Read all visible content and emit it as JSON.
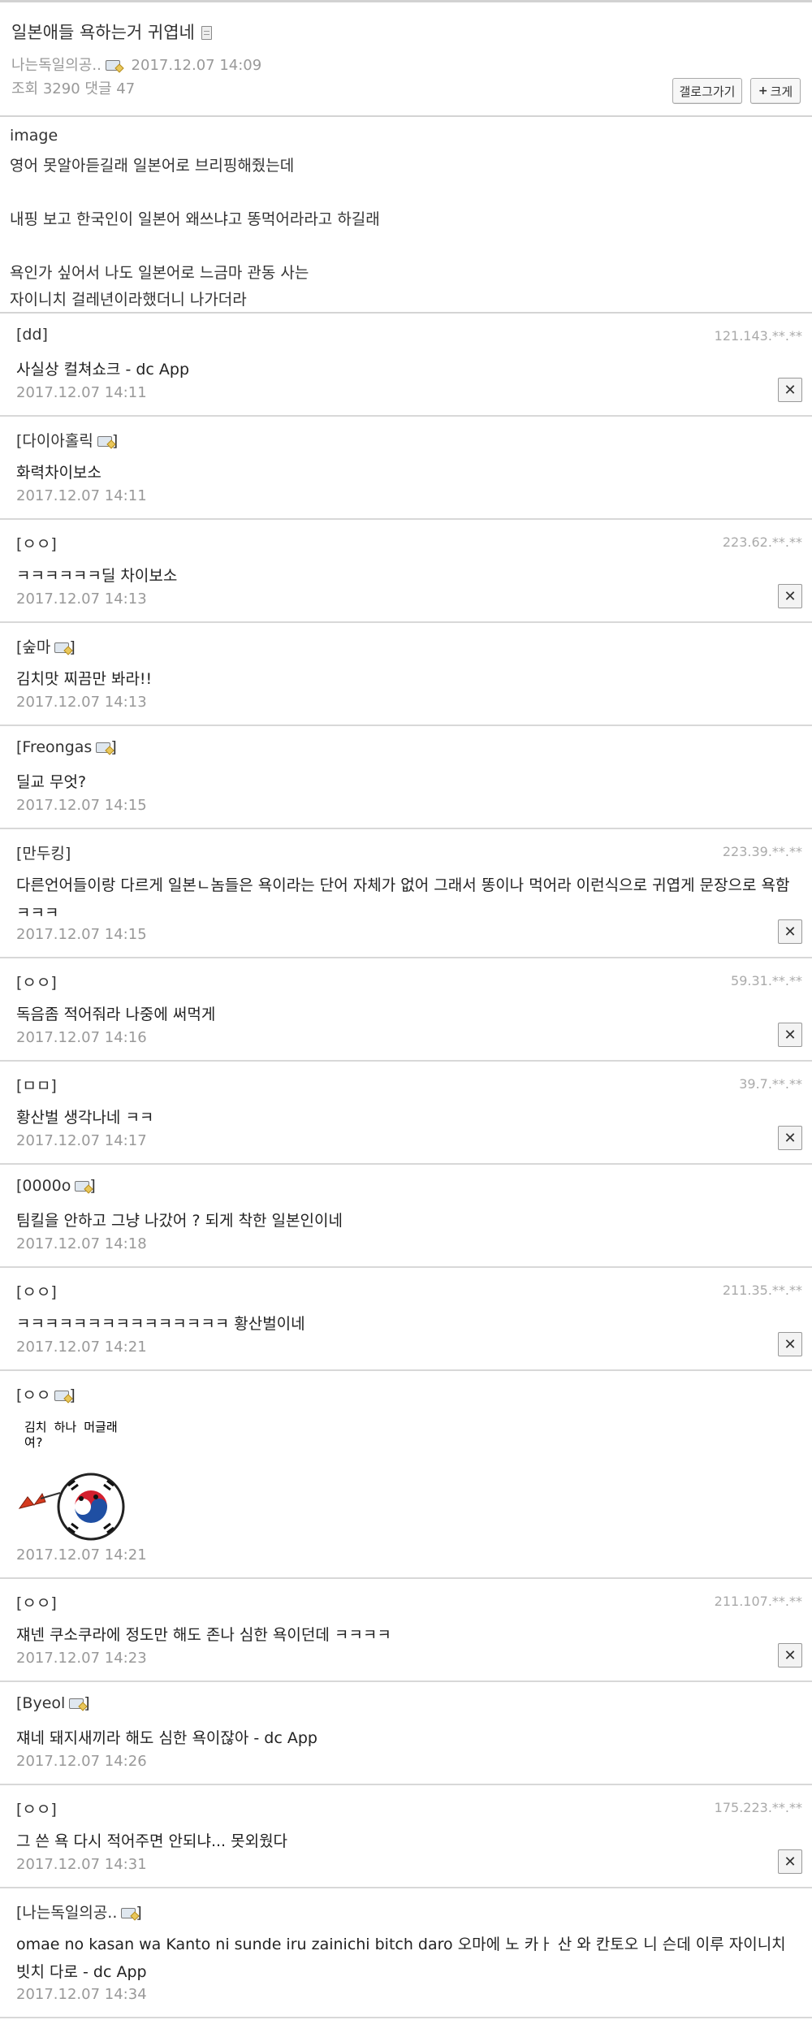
{
  "post": {
    "title": "일본애들 욕하는거 귀엽네",
    "author": "나는독일의공..",
    "date": "2017.12.07 14:09",
    "views_label": "조회",
    "views": "3290",
    "comments_label": "댓글",
    "comment_count": "47",
    "buttons": {
      "gallery": "갤로그가기",
      "enlarge": "크게"
    },
    "body": [
      "image",
      "영어 못알아듣길래 일본어로 브리핑해줬는데",
      "내핑 보고 한국인이 일본어 왜쓰냐고 똥먹어라라고 하길래",
      "욕인가 싶어서 나도 일본어로 느금마 관동 사는",
      "자이니치 걸레년이라했더니 나가더라"
    ]
  },
  "icons": {
    "doc": "document-icon",
    "gallog": "gallog-icon",
    "delete": "close-icon",
    "plus": "plus-icon"
  },
  "comments": [
    {
      "nick": "[dd]",
      "ip": "121.143.**.**",
      "text": "사실상 컬쳐쇼크 - dc App",
      "date": "2017.12.07 14:11",
      "deletable": true
    },
    {
      "nick": "[다이아홀릭",
      "gallog": true,
      "text": "화력차이보소",
      "date": "2017.12.07 14:11",
      "deletable": false
    },
    {
      "nick": "[ㅇㅇ]",
      "ip": "223.62.**.**",
      "text": "ㅋㅋㅋㅋㅋㅋ딜 차이보소",
      "date": "2017.12.07 14:13",
      "deletable": true
    },
    {
      "nick": "[숲마",
      "gallog": true,
      "text": "김치맛 찌끔만 봐라!!",
      "date": "2017.12.07 14:13",
      "deletable": false
    },
    {
      "nick": "[Freongas",
      "gallog": true,
      "text": "딜교 무엇?",
      "date": "2017.12.07 14:15",
      "deletable": false
    },
    {
      "nick": "[만두킹]",
      "ip": "223.39.**.**",
      "text": "다른언어들이랑 다르게 일본ㄴ놈들은 욕이라는 단어 자체가 없어 그래서 똥이나 먹어라 이런식으로 귀엽게 문장으로 욕함ㅋㅋㅋ",
      "date": "2017.12.07 14:15",
      "deletable": true
    },
    {
      "nick": "[ㅇㅇ]",
      "ip": "59.31.**.**",
      "text": "독음좀 적어줘라 나중에 써먹게",
      "date": "2017.12.07 14:16",
      "deletable": true
    },
    {
      "nick": "[ㅁㅁ]",
      "ip": "39.7.**.**",
      "text": "황산벌 생각나네 ㅋㅋ",
      "date": "2017.12.07 14:17",
      "deletable": true
    },
    {
      "nick": "[0000o",
      "gallog": true,
      "text": "팀킬을 안하고 그냥 나갔어 ? 되게 착한 일본인이네",
      "date": "2017.12.07 14:18",
      "deletable": false
    },
    {
      "nick": "[ㅇㅇ]",
      "ip": "211.35.**.**",
      "text": "ㅋㅋㅋㅋㅋㅋㅋㅋㅋㅋㅋㅋㅋㅋㅋ 황산벌이네",
      "date": "2017.12.07 14:21",
      "deletable": true
    },
    {
      "nick": "[ㅇㅇ",
      "gallog": true,
      "dccon_caption": "김치 하나 머글래\n여?",
      "date": "2017.12.07 14:21",
      "deletable": false
    },
    {
      "nick": "[ㅇㅇ]",
      "ip": "211.107.**.**",
      "text": "쟤넨 쿠소쿠라에 정도만 해도 존나 심한 욕이던데 ㅋㅋㅋㅋ",
      "date": "2017.12.07 14:23",
      "deletable": true
    },
    {
      "nick": "[Byeol",
      "gallog": true,
      "text": "쟤네 돼지새끼라 해도 심한 욕이잖아 - dc App",
      "date": "2017.12.07 14:26",
      "deletable": false
    },
    {
      "nick": "[ㅇㅇ]",
      "ip": "175.223.**.**",
      "text": "그 쓴 욕 다시 적어주면 안되냐... 못외웠다",
      "date": "2017.12.07 14:31",
      "deletable": true
    },
    {
      "nick": "[나는독일의공..",
      "gallog": true,
      "text": "omae no kasan wa Kanto ni sunde iru zainichi bitch daro 오마에 노 카ㅏ 산 와 칸토오 니 슨데 이루 자이니치 빗치 다로 - dc App",
      "date": "2017.12.07 14:34",
      "deletable": false
    }
  ]
}
